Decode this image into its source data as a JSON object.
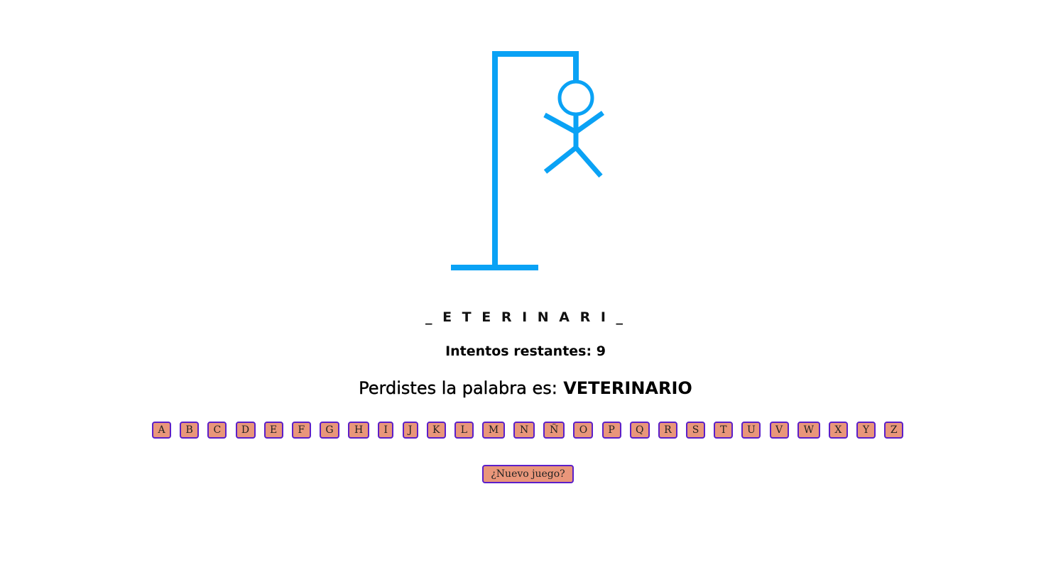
{
  "game": {
    "masked_word": "_ E T E R I N A R I _",
    "attempts_text": "Intentos restantes: 9",
    "lose_message": "Perdistes la palabra es:",
    "secret_word": "VETERINARIO",
    "new_game_label": "¿Nuevo juego?",
    "drawing_color": "#0aa2f5",
    "button_bg": "#e9967a",
    "button_border": "#5b1fc9"
  },
  "letters": [
    "A",
    "B",
    "C",
    "D",
    "E",
    "F",
    "G",
    "H",
    "I",
    "J",
    "K",
    "L",
    "M",
    "N",
    "Ñ",
    "O",
    "P",
    "Q",
    "R",
    "S",
    "T",
    "U",
    "V",
    "W",
    "X",
    "Y",
    "Z"
  ]
}
